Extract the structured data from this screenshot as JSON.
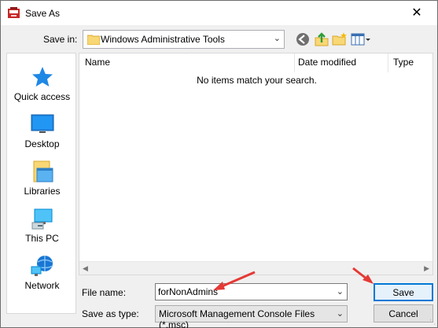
{
  "window": {
    "title": "Save As",
    "close_glyph": "✕"
  },
  "save_in": {
    "label": "Save in:",
    "value": "Windows Administrative Tools"
  },
  "toolbar": {
    "back_icon": "back-icon",
    "up_icon": "up-folder-icon",
    "new_folder_icon": "new-folder-icon",
    "view_menu_icon": "view-menu-icon"
  },
  "places": [
    {
      "label": "Quick access",
      "icon": "star-icon"
    },
    {
      "label": "Desktop",
      "icon": "desktop-icon"
    },
    {
      "label": "Libraries",
      "icon": "libraries-icon"
    },
    {
      "label": "This PC",
      "icon": "this-pc-icon"
    },
    {
      "label": "Network",
      "icon": "network-icon"
    }
  ],
  "file_list": {
    "columns": [
      "Name",
      "Date modified",
      "Type"
    ],
    "empty_message": "No items match your search."
  },
  "file_name": {
    "label": "File name:",
    "value": "forNonAdmins"
  },
  "save_as_type": {
    "label": "Save as type:",
    "value": "Microsoft Management Console Files (*.msc)"
  },
  "buttons": {
    "save": "Save",
    "cancel": "Cancel"
  },
  "colors": {
    "accent": "#0078d7",
    "annotation_arrow": "#e53935"
  }
}
